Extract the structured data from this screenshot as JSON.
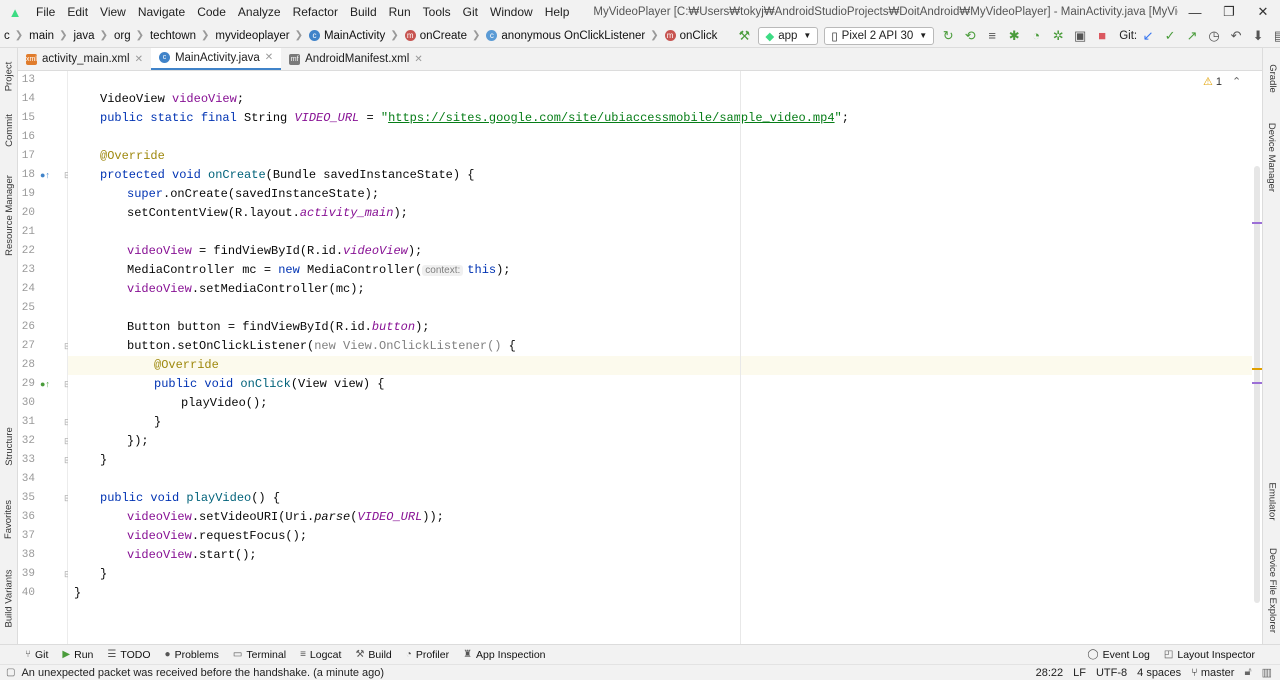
{
  "menubar": {
    "items": [
      "File",
      "Edit",
      "View",
      "Navigate",
      "Code",
      "Analyze",
      "Refactor",
      "Build",
      "Run",
      "Tools",
      "Git",
      "Window",
      "Help"
    ],
    "window_title": "MyVideoPlayer [C:₩Users₩tokyj₩AndroidStudioProjects₩DoitAndroid₩MyVideoPlayer] - MainActivity.java [MyVideoPlayer.app]",
    "controls": {
      "minimize": "—",
      "restore": "❐",
      "close": "✕"
    }
  },
  "breadcrumb": {
    "items": [
      "c",
      "main",
      "java",
      "org",
      "techtown",
      "myvideoplayer",
      "MainActivity",
      "onCreate",
      "anonymous OnClickListener",
      "onClick"
    ]
  },
  "run_toolbar": {
    "config": "app",
    "device": "Pixel 2 API 30",
    "git_label": "Git:"
  },
  "tabs": [
    {
      "label": "activity_main.xml",
      "icon": "xml-file-icon"
    },
    {
      "label": "MainActivity.java",
      "icon": "java-class-icon",
      "active": true
    },
    {
      "label": "AndroidManifest.xml",
      "icon": "manifest-file-icon"
    }
  ],
  "left_tools": [
    "Project",
    "Commit",
    "Resource Manager",
    "Structure",
    "Favorites",
    "Build Variants"
  ],
  "right_tools": [
    "Gradle",
    "Device Manager",
    "Emulator",
    "Device File Explorer"
  ],
  "editor": {
    "warning_count": "1",
    "line_numbers": [
      "13",
      "14",
      "15",
      "16",
      "17",
      "18",
      "19",
      "20",
      "21",
      "22",
      "23",
      "24",
      "25",
      "26",
      "27",
      "28",
      "29",
      "30",
      "31",
      "32",
      "33",
      "34",
      "35",
      "36",
      "37",
      "38",
      "39",
      "40"
    ],
    "parameter_hint": "context:"
  },
  "bottom_tools": [
    "Git",
    "Run",
    "TODO",
    "Problems",
    "Terminal",
    "Logcat",
    "Build",
    "Profiler",
    "App Inspection",
    "Event Log",
    "Layout Inspector"
  ],
  "status": {
    "message": "An unexpected packet was received before the handshake. (a minute ago)",
    "position": "28:22",
    "line_sep": "LF",
    "encoding": "UTF-8",
    "indent": "4 spaces",
    "branch": "master"
  },
  "colors": {
    "accent": "#4083c9",
    "keyword": "#0033b3",
    "string": "#067d17",
    "annotation": "#9e880d",
    "field": "#871094"
  }
}
